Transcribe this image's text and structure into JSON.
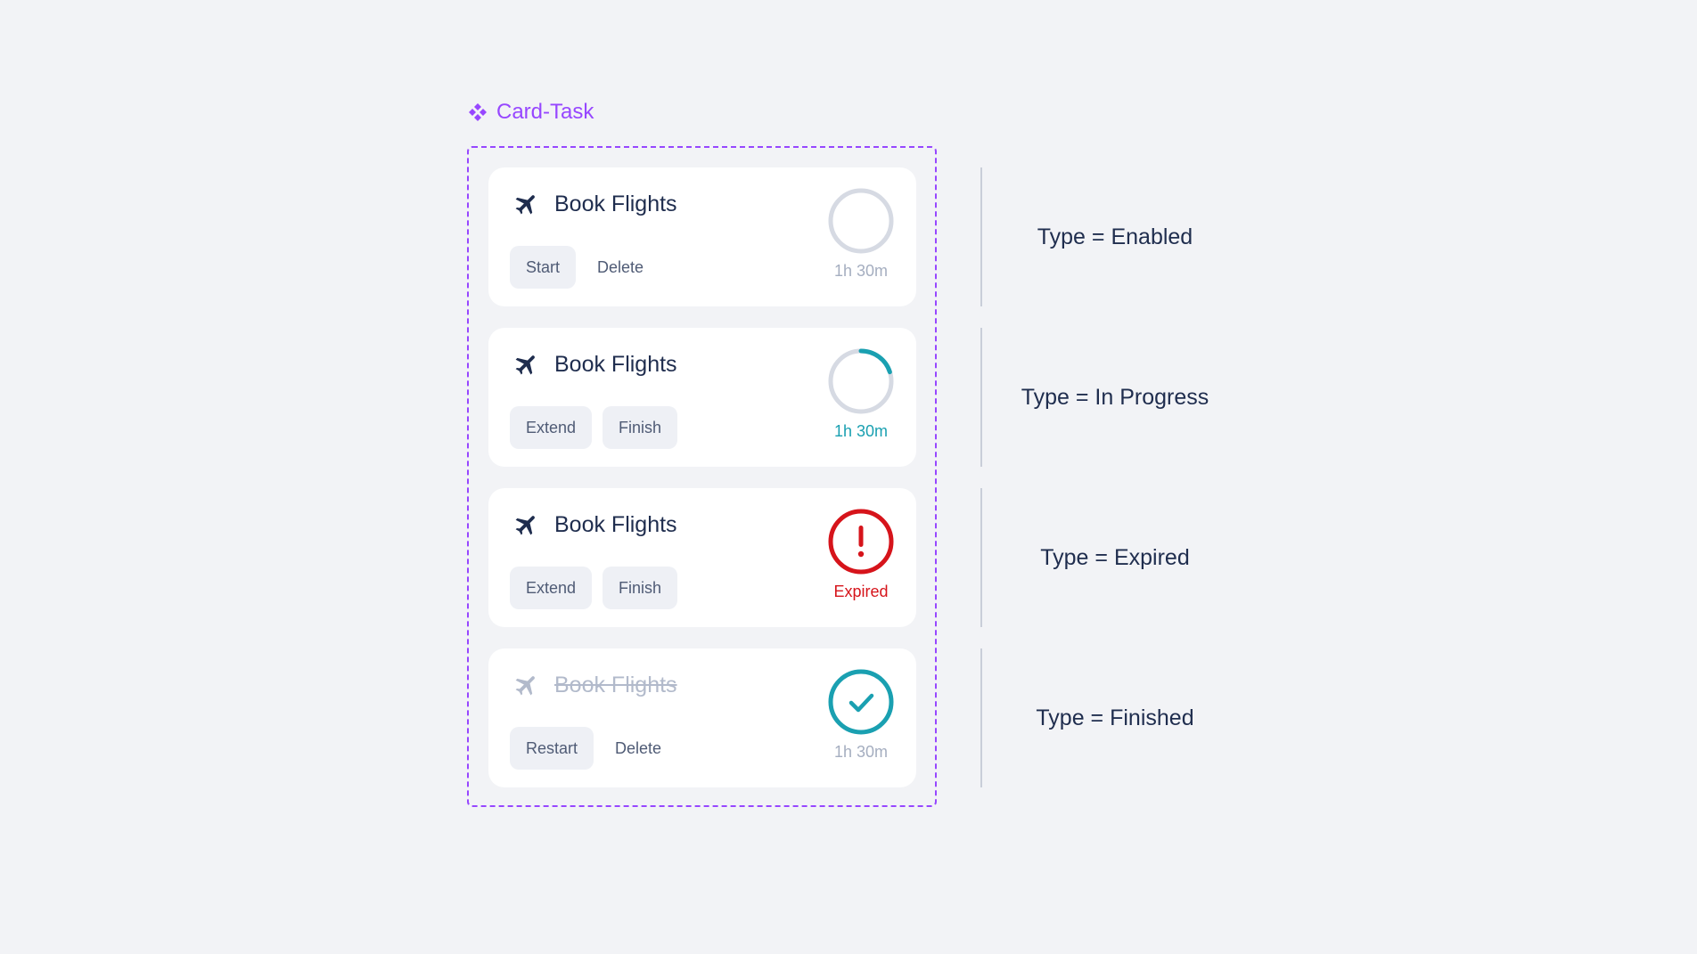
{
  "component": {
    "name": "Card-Task",
    "icon": "component-diamond-icon",
    "accent": "#9747ff"
  },
  "colors": {
    "background": "#f2f3f6",
    "card": "#ffffff",
    "title": "#1f2d4e",
    "teal": "#1aa0b1",
    "red": "#d6141b",
    "muted": "#a5aec0"
  },
  "cards": [
    {
      "state": "enabled",
      "icon": "airplane-icon",
      "title": "Book Flights",
      "actions": [
        "Start",
        "Delete"
      ],
      "status_icon": "empty-ring-icon",
      "meta": "1h 30m"
    },
    {
      "state": "in-progress",
      "icon": "airplane-icon",
      "title": "Book Flights",
      "actions": [
        "Extend",
        "Finish"
      ],
      "status_icon": "progress-ring-icon",
      "progress": 0.2,
      "meta": "1h 30m"
    },
    {
      "state": "expired",
      "icon": "airplane-icon",
      "title": "Book Flights",
      "actions": [
        "Extend",
        "Finish"
      ],
      "status_icon": "exclamation-ring-icon",
      "meta": "Expired"
    },
    {
      "state": "finished",
      "icon": "airplane-icon",
      "title": "Book Flights",
      "actions": [
        "Restart",
        "Delete"
      ],
      "status_icon": "check-ring-icon",
      "meta": "1h 30m"
    }
  ],
  "variants": [
    "Type = Enabled",
    "Type = In Progress",
    "Type = Expired",
    "Type = Finished"
  ]
}
